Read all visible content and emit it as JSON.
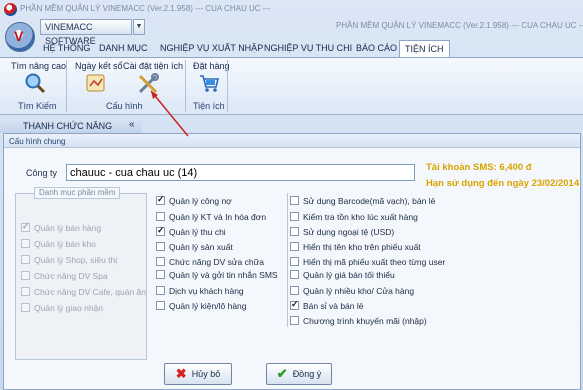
{
  "window": {
    "title": "PHẦN MỀM QUẢN LÝ VINEMACC (Ver.2.1.958) --- CUA CHAU UC ---",
    "title_right": "PHẦN MỀM QUẢN LÝ VINEMACC (Ver.2.1.958) --- CUA CHAU UC ---",
    "app_name": "VINEMACC SOFTWARE"
  },
  "menu": {
    "tabs": [
      {
        "label": "HỆ THỐNG"
      },
      {
        "label": "DANH MỤC"
      },
      {
        "label": "NGHIỆP VỤ XUẤT NHẬP"
      },
      {
        "label": "NGHIỆP VỤ THU CHI"
      },
      {
        "label": "BÁO CÁO"
      },
      {
        "label": "TIỆN ÍCH"
      }
    ],
    "active": "TIỆN ÍCH"
  },
  "ribbon": {
    "groups": [
      {
        "label": "Tìm Kiếm",
        "buttons": [
          {
            "label": "Tìm nâng cao",
            "icon": "magnifier-icon"
          }
        ]
      },
      {
        "label": "Cấu hình",
        "buttons": [
          {
            "label": "Ngày kết sổ",
            "icon": "calendar-icon"
          },
          {
            "label": "Cài đặt tiện ích",
            "icon": "tools-icon"
          }
        ]
      },
      {
        "label": "Tiện ích",
        "buttons": [
          {
            "label": "Đặt hàng",
            "icon": "cart-icon"
          }
        ]
      }
    ]
  },
  "left_panel": {
    "title": "THANH CHỨC NĂNG",
    "collapse": "«"
  },
  "dialog": {
    "title": "Cấu hình chung",
    "company_label": "Công ty",
    "company_value": "chauuc - cua chau uc (14)",
    "sms": "Tài khoản SMS: 6,400 đ",
    "expiry": "Hạn sử dụng đến ngày 23/02/2014",
    "catalog_legend": "Danh mục phần mềm",
    "catalog_items": [
      {
        "label": "Quản lý bán hàng",
        "checked": true
      },
      {
        "label": "Quản lý bán kho",
        "checked": false
      },
      {
        "label": "Quản lý Shop, siêu thị",
        "checked": false
      },
      {
        "label": "Chức năng DV Spa",
        "checked": false
      },
      {
        "label": "Chức năng DV Cafe, quán ăn",
        "checked": false
      },
      {
        "label": "Quản lý giao nhận",
        "checked": false
      }
    ],
    "col2": [
      {
        "label": "Quản lý công nợ",
        "checked": true
      },
      {
        "label": "Quản lý KT và In hóa đơn",
        "checked": false
      },
      {
        "label": "Quản lý thu chi",
        "checked": true
      },
      {
        "label": "Quản lý sản xuất",
        "checked": false
      },
      {
        "label": "Chức năng DV sửa chữa",
        "checked": false
      },
      {
        "label": "Quản lý và gởi tin nhắn SMS",
        "checked": false
      },
      {
        "label": "Dịch vụ khách hàng",
        "checked": false
      },
      {
        "label": "Quản lý kiện/lô hàng",
        "checked": false
      }
    ],
    "col3": [
      {
        "label": "Sử dụng Barcode(mã vạch), bán lẻ",
        "checked": false
      },
      {
        "label": "Kiểm tra tồn kho lúc xuất hàng",
        "checked": false
      },
      {
        "label": "Sử dụng ngoại tệ (USD)",
        "checked": false
      },
      {
        "label": "Hiển thị tên kho trên phiếu xuất",
        "checked": false
      },
      {
        "label": "Hiển thị mã phiếu xuất theo từng user",
        "checked": false
      },
      {
        "label": "Quản lý giá bán tối thiểu",
        "checked": false
      },
      {
        "label": "Quản lý nhiều kho/ Cửa hàng",
        "checked": false
      },
      {
        "label": "Bán sỉ và bán lẻ",
        "checked": true
      },
      {
        "label": "Chương trình khuyến mãi (nhập)",
        "checked": false
      }
    ],
    "buttons": {
      "cancel": "Hủy bỏ",
      "ok": "Đồng ý"
    }
  },
  "colors": {
    "accent": "#d9a400",
    "annotation": "#cc2222"
  }
}
